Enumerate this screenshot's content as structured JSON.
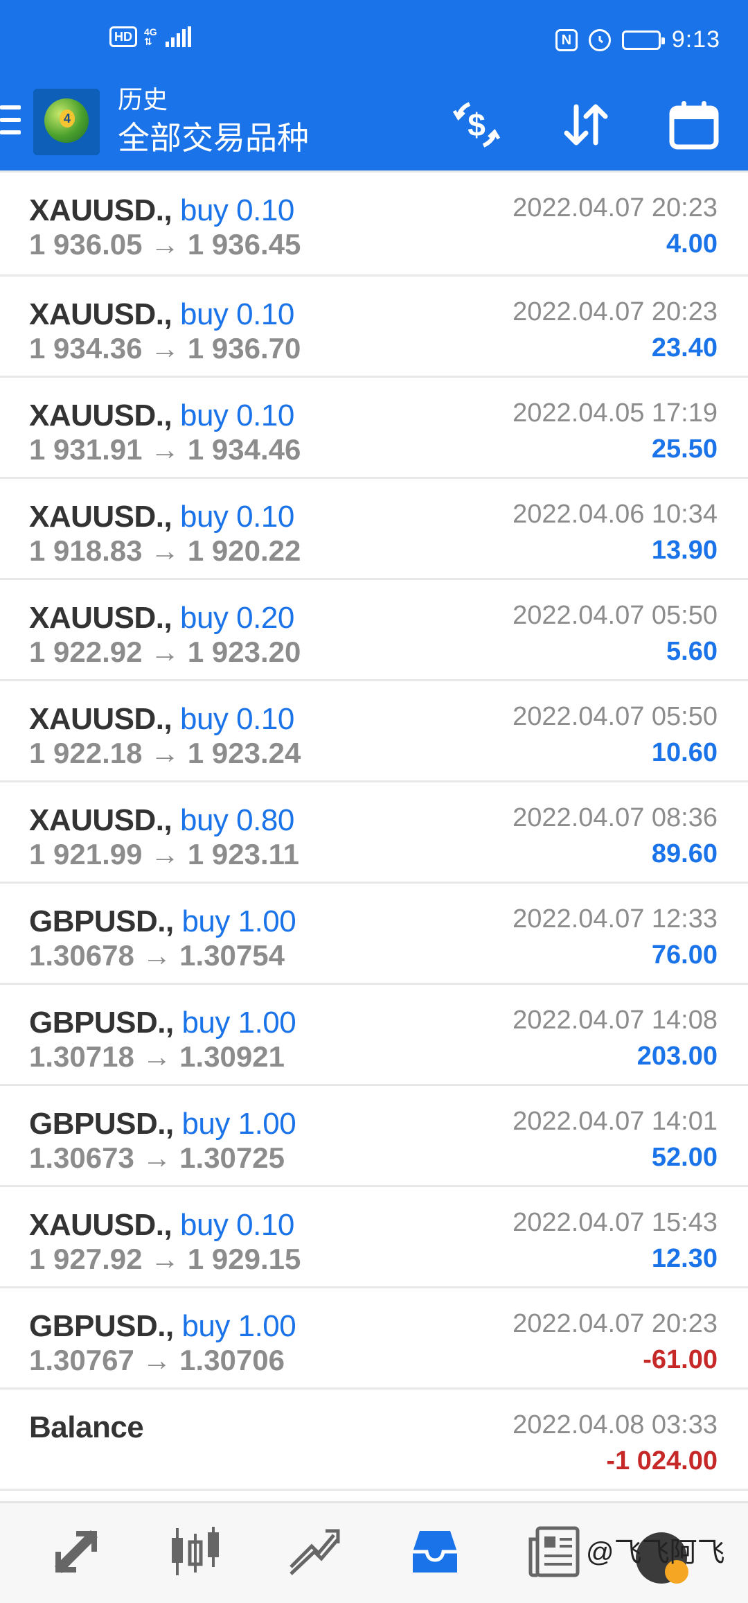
{
  "status_bar": {
    "hd": "HD",
    "network_top": "4G",
    "network_bottom": "⇅",
    "time": "9:13",
    "nfc": "N",
    "alarm": "⏰"
  },
  "app_bar": {
    "subtitle": "历史",
    "title": "全部交易品种",
    "icons": [
      "menu-icon",
      "metatrader-logo",
      "currency-exchange-icon",
      "sort-icon",
      "calendar-icon"
    ]
  },
  "arrow": "→",
  "trades": [
    {
      "symbol": "XAUUSD.,",
      "side": "buy 0.10",
      "open": "1 936.05",
      "close": "1 936.45",
      "time": "2022.04.07 20:23",
      "profit": "4.00",
      "negative": false
    },
    {
      "symbol": "XAUUSD.,",
      "side": "buy 0.10",
      "open": "1 934.36",
      "close": "1 936.70",
      "time": "2022.04.07 20:23",
      "profit": "23.40",
      "negative": false
    },
    {
      "symbol": "XAUUSD.,",
      "side": "buy 0.10",
      "open": "1 931.91",
      "close": "1 934.46",
      "time": "2022.04.05 17:19",
      "profit": "25.50",
      "negative": false
    },
    {
      "symbol": "XAUUSD.,",
      "side": "buy 0.10",
      "open": "1 918.83",
      "close": "1 920.22",
      "time": "2022.04.06 10:34",
      "profit": "13.90",
      "negative": false
    },
    {
      "symbol": "XAUUSD.,",
      "side": "buy 0.20",
      "open": "1 922.92",
      "close": "1 923.20",
      "time": "2022.04.07 05:50",
      "profit": "5.60",
      "negative": false
    },
    {
      "symbol": "XAUUSD.,",
      "side": "buy 0.10",
      "open": "1 922.18",
      "close": "1 923.24",
      "time": "2022.04.07 05:50",
      "profit": "10.60",
      "negative": false
    },
    {
      "symbol": "XAUUSD.,",
      "side": "buy 0.80",
      "open": "1 921.99",
      "close": "1 923.11",
      "time": "2022.04.07 08:36",
      "profit": "89.60",
      "negative": false
    },
    {
      "symbol": "GBPUSD.,",
      "side": "buy 1.00",
      "open": "1.30678",
      "close": "1.30754",
      "time": "2022.04.07 12:33",
      "profit": "76.00",
      "negative": false
    },
    {
      "symbol": "GBPUSD.,",
      "side": "buy 1.00",
      "open": "1.30718",
      "close": "1.30921",
      "time": "2022.04.07 14:08",
      "profit": "203.00",
      "negative": false
    },
    {
      "symbol": "GBPUSD.,",
      "side": "buy 1.00",
      "open": "1.30673",
      "close": "1.30725",
      "time": "2022.04.07 14:01",
      "profit": "52.00",
      "negative": false
    },
    {
      "symbol": "XAUUSD.,",
      "side": "buy 0.10",
      "open": "1 927.92",
      "close": "1 929.15",
      "time": "2022.04.07 15:43",
      "profit": "12.30",
      "negative": false
    },
    {
      "symbol": "GBPUSD.,",
      "side": "buy 1.00",
      "open": "1.30767",
      "close": "1.30706",
      "time": "2022.04.07 20:23",
      "profit": "-61.00",
      "negative": true
    }
  ],
  "balance": {
    "label": "Balance",
    "time": "2022.04.08 03:33",
    "amount": "-1 024.00"
  },
  "bottom_nav": {
    "items": [
      "quotes-icon",
      "chart-icon",
      "trade-icon",
      "history-icon",
      "news-icon"
    ],
    "active": "history-icon",
    "watermark": "@飞飞阿飞"
  },
  "colors": {
    "primary": "#1a73e8",
    "profit_positive": "#1a73e8",
    "profit_negative": "#c62828",
    "muted_text": "#8c8c8c",
    "symbol_text": "#333333"
  }
}
